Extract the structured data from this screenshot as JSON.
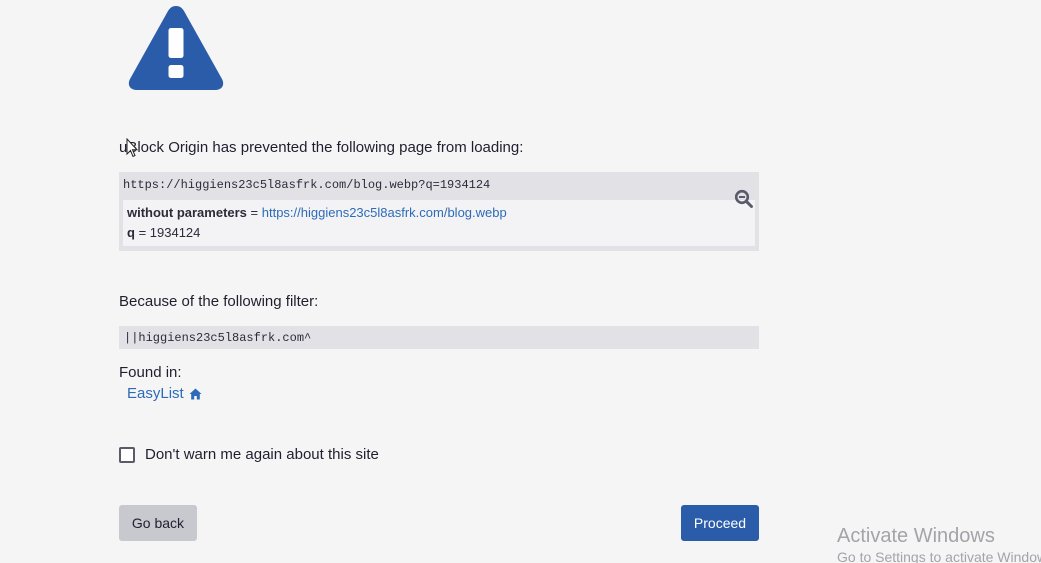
{
  "headline": "uBlock Origin has prevented the following page from loading:",
  "blocked": {
    "url": "https://higgiens23c5l8asfrk.com/blog.webp?q=1934124",
    "without_params_label": "without parameters",
    "equals": " = ",
    "without_params_value": "https://higgiens23c5l8asfrk.com/blog.webp",
    "param_name": "q",
    "param_value": "1934124"
  },
  "filter": {
    "label": "Because of the following filter:",
    "value": "||higgiens23c5l8asfrk.com^"
  },
  "found_in": {
    "label": "Found in:",
    "list_name": "EasyList"
  },
  "dont_warn_label": "Don't warn me again about this site",
  "buttons": {
    "back": "Go back",
    "proceed": "Proceed"
  },
  "watermark": {
    "title": "Activate Windows",
    "subtitle": "Go to Settings to activate Windows."
  },
  "colors": {
    "accent": "#2a5caa",
    "link": "#2d6bb8",
    "box": "#e2e2e6"
  },
  "icons": [
    "warning-icon",
    "zoom-icon",
    "home-icon",
    "cursor-icon"
  ]
}
